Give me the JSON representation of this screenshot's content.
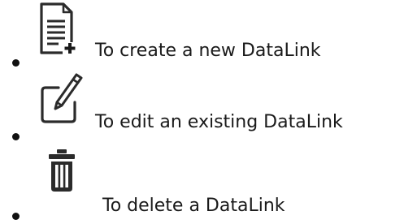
{
  "items": [
    {
      "icon": "new-document-icon",
      "label": "To create a new DataLink"
    },
    {
      "icon": "edit-pencil-icon",
      "label": "To edit an existing DataLink"
    },
    {
      "icon": "trash-can-icon",
      "label": "To delete a DataLink"
    }
  ],
  "colors": {
    "text": "#1a1a1a",
    "icon": "#2b2b2b",
    "bullet": "#111111"
  }
}
